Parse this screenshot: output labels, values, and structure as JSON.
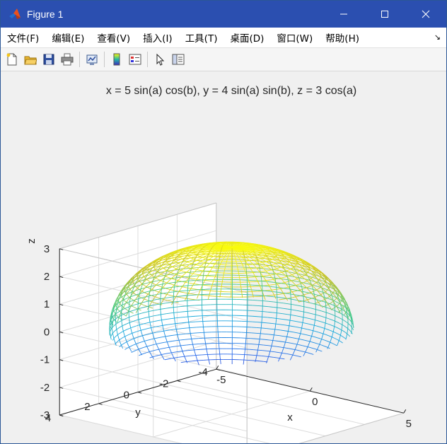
{
  "window": {
    "title": "Figure 1",
    "minimize_icon": "minimize-icon",
    "maximize_icon": "maximize-icon",
    "close_icon": "close-icon"
  },
  "menu": {
    "items": [
      {
        "label": "文件(F)"
      },
      {
        "label": "编辑(E)"
      },
      {
        "label": "查看(V)"
      },
      {
        "label": "插入(I)"
      },
      {
        "label": "工具(T)"
      },
      {
        "label": "桌面(D)"
      },
      {
        "label": "窗口(W)"
      },
      {
        "label": "帮助(H)"
      }
    ]
  },
  "toolbar": {
    "buttons": [
      "new-figure-icon",
      "open-file-icon",
      "save-icon",
      "print-icon",
      "link-plot-icon",
      "colorbar-icon",
      "legend-icon",
      "pointer-icon",
      "property-inspector-icon"
    ]
  },
  "chart_data": {
    "type": "surface-mesh-3d",
    "title": "x = 5 sin(a) cos(b), y = 4 sin(a) sin(b), z = 3 cos(a)",
    "surface": {
      "x_expr": "5 sin(a) cos(b)",
      "y_expr": "4 sin(a) sin(b)",
      "z_expr": "3 cos(a)",
      "semi_axes": {
        "x": 5,
        "y": 4,
        "z": 3
      },
      "mesh_rows": 50,
      "mesh_cols": 50,
      "colormap": "parula",
      "color_by": "z"
    },
    "xlabel": "x",
    "ylabel": "y",
    "zlabel": "z",
    "xlim": [
      -5,
      5
    ],
    "ylim": [
      -4,
      4
    ],
    "zlim": [
      -3,
      3
    ],
    "xticks": [
      -5,
      0,
      5
    ],
    "yticks": [
      -4,
      -2,
      0,
      2,
      4
    ],
    "zticks": [
      -3,
      -2,
      -1,
      0,
      1,
      2,
      3
    ],
    "xtick_labels": [
      "-5",
      "0",
      "5"
    ],
    "ytick_labels": [
      "-4",
      "-2",
      "0",
      "2",
      "4"
    ],
    "ztick_labels": [
      "-3",
      "-2",
      "-1",
      "0",
      "1",
      "2",
      "3"
    ],
    "grid": true,
    "box": "three back planes"
  }
}
